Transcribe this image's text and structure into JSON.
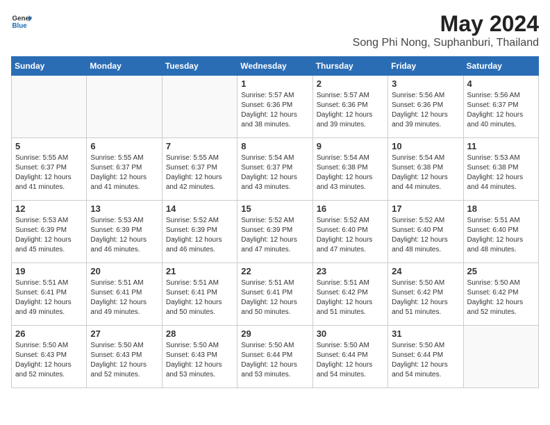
{
  "header": {
    "logo_general": "General",
    "logo_blue": "Blue",
    "title": "May 2024",
    "subtitle": "Song Phi Nong, Suphanburi, Thailand"
  },
  "weekdays": [
    "Sunday",
    "Monday",
    "Tuesday",
    "Wednesday",
    "Thursday",
    "Friday",
    "Saturday"
  ],
  "rows": [
    [
      {
        "day": "",
        "info": ""
      },
      {
        "day": "",
        "info": ""
      },
      {
        "day": "",
        "info": ""
      },
      {
        "day": "1",
        "info": "Sunrise: 5:57 AM\nSunset: 6:36 PM\nDaylight: 12 hours\nand 38 minutes."
      },
      {
        "day": "2",
        "info": "Sunrise: 5:57 AM\nSunset: 6:36 PM\nDaylight: 12 hours\nand 39 minutes."
      },
      {
        "day": "3",
        "info": "Sunrise: 5:56 AM\nSunset: 6:36 PM\nDaylight: 12 hours\nand 39 minutes."
      },
      {
        "day": "4",
        "info": "Sunrise: 5:56 AM\nSunset: 6:37 PM\nDaylight: 12 hours\nand 40 minutes."
      }
    ],
    [
      {
        "day": "5",
        "info": "Sunrise: 5:55 AM\nSunset: 6:37 PM\nDaylight: 12 hours\nand 41 minutes."
      },
      {
        "day": "6",
        "info": "Sunrise: 5:55 AM\nSunset: 6:37 PM\nDaylight: 12 hours\nand 41 minutes."
      },
      {
        "day": "7",
        "info": "Sunrise: 5:55 AM\nSunset: 6:37 PM\nDaylight: 12 hours\nand 42 minutes."
      },
      {
        "day": "8",
        "info": "Sunrise: 5:54 AM\nSunset: 6:37 PM\nDaylight: 12 hours\nand 43 minutes."
      },
      {
        "day": "9",
        "info": "Sunrise: 5:54 AM\nSunset: 6:38 PM\nDaylight: 12 hours\nand 43 minutes."
      },
      {
        "day": "10",
        "info": "Sunrise: 5:54 AM\nSunset: 6:38 PM\nDaylight: 12 hours\nand 44 minutes."
      },
      {
        "day": "11",
        "info": "Sunrise: 5:53 AM\nSunset: 6:38 PM\nDaylight: 12 hours\nand 44 minutes."
      }
    ],
    [
      {
        "day": "12",
        "info": "Sunrise: 5:53 AM\nSunset: 6:39 PM\nDaylight: 12 hours\nand 45 minutes."
      },
      {
        "day": "13",
        "info": "Sunrise: 5:53 AM\nSunset: 6:39 PM\nDaylight: 12 hours\nand 46 minutes."
      },
      {
        "day": "14",
        "info": "Sunrise: 5:52 AM\nSunset: 6:39 PM\nDaylight: 12 hours\nand 46 minutes."
      },
      {
        "day": "15",
        "info": "Sunrise: 5:52 AM\nSunset: 6:39 PM\nDaylight: 12 hours\nand 47 minutes."
      },
      {
        "day": "16",
        "info": "Sunrise: 5:52 AM\nSunset: 6:40 PM\nDaylight: 12 hours\nand 47 minutes."
      },
      {
        "day": "17",
        "info": "Sunrise: 5:52 AM\nSunset: 6:40 PM\nDaylight: 12 hours\nand 48 minutes."
      },
      {
        "day": "18",
        "info": "Sunrise: 5:51 AM\nSunset: 6:40 PM\nDaylight: 12 hours\nand 48 minutes."
      }
    ],
    [
      {
        "day": "19",
        "info": "Sunrise: 5:51 AM\nSunset: 6:41 PM\nDaylight: 12 hours\nand 49 minutes."
      },
      {
        "day": "20",
        "info": "Sunrise: 5:51 AM\nSunset: 6:41 PM\nDaylight: 12 hours\nand 49 minutes."
      },
      {
        "day": "21",
        "info": "Sunrise: 5:51 AM\nSunset: 6:41 PM\nDaylight: 12 hours\nand 50 minutes."
      },
      {
        "day": "22",
        "info": "Sunrise: 5:51 AM\nSunset: 6:41 PM\nDaylight: 12 hours\nand 50 minutes."
      },
      {
        "day": "23",
        "info": "Sunrise: 5:51 AM\nSunset: 6:42 PM\nDaylight: 12 hours\nand 51 minutes."
      },
      {
        "day": "24",
        "info": "Sunrise: 5:50 AM\nSunset: 6:42 PM\nDaylight: 12 hours\nand 51 minutes."
      },
      {
        "day": "25",
        "info": "Sunrise: 5:50 AM\nSunset: 6:42 PM\nDaylight: 12 hours\nand 52 minutes."
      }
    ],
    [
      {
        "day": "26",
        "info": "Sunrise: 5:50 AM\nSunset: 6:43 PM\nDaylight: 12 hours\nand 52 minutes."
      },
      {
        "day": "27",
        "info": "Sunrise: 5:50 AM\nSunset: 6:43 PM\nDaylight: 12 hours\nand 52 minutes."
      },
      {
        "day": "28",
        "info": "Sunrise: 5:50 AM\nSunset: 6:43 PM\nDaylight: 12 hours\nand 53 minutes."
      },
      {
        "day": "29",
        "info": "Sunrise: 5:50 AM\nSunset: 6:44 PM\nDaylight: 12 hours\nand 53 minutes."
      },
      {
        "day": "30",
        "info": "Sunrise: 5:50 AM\nSunset: 6:44 PM\nDaylight: 12 hours\nand 54 minutes."
      },
      {
        "day": "31",
        "info": "Sunrise: 5:50 AM\nSunset: 6:44 PM\nDaylight: 12 hours\nand 54 minutes."
      },
      {
        "day": "",
        "info": ""
      }
    ]
  ]
}
